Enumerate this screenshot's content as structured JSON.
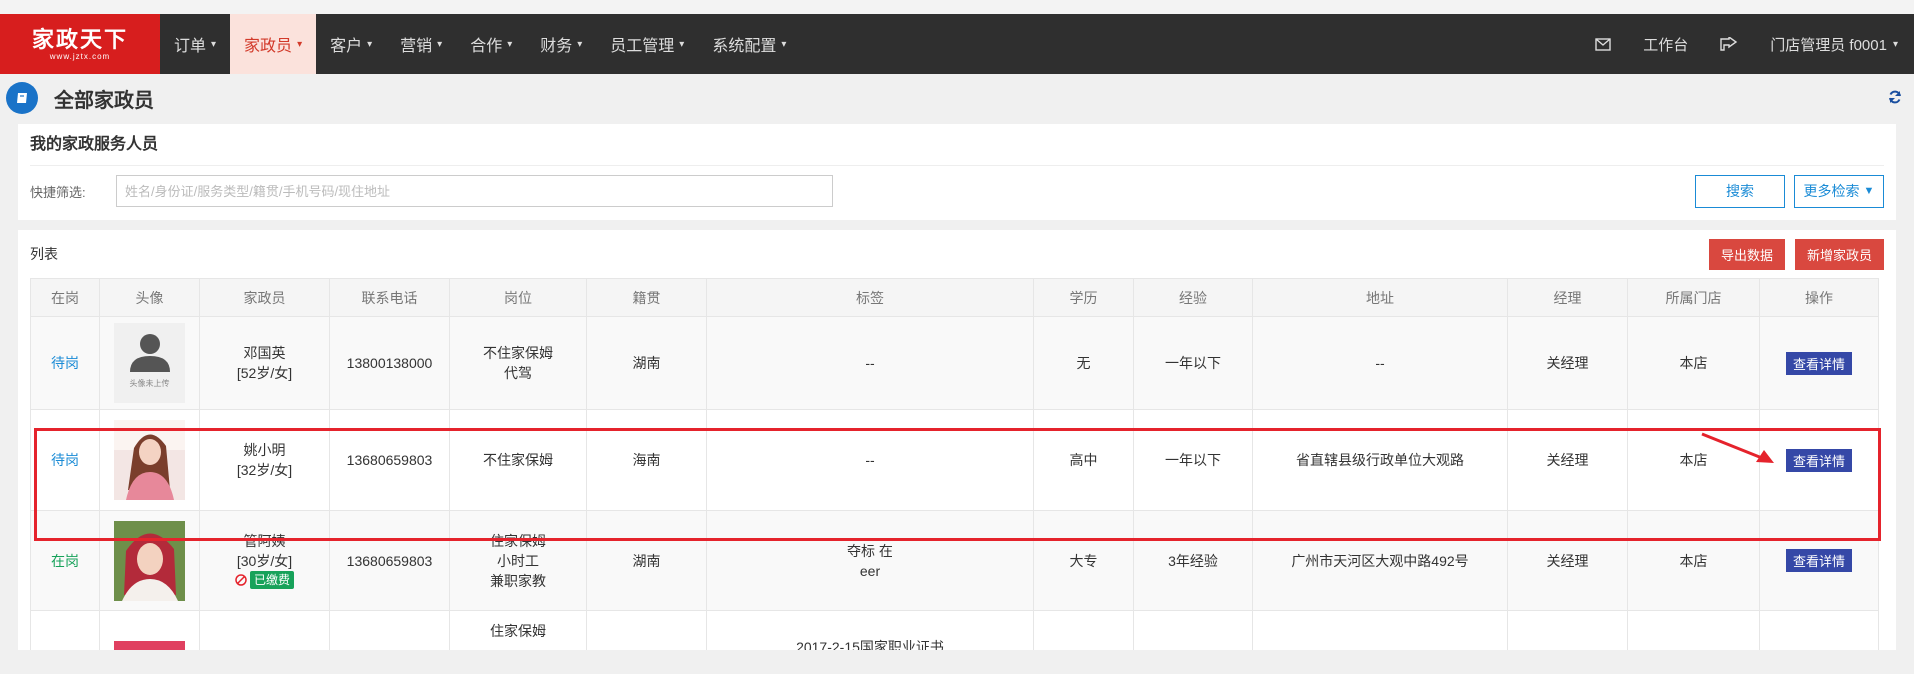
{
  "logo": {
    "brand": "家政天下",
    "domain": "www.jztx.com"
  },
  "nav": {
    "items": [
      {
        "label": "订单"
      },
      {
        "label": "家政员"
      },
      {
        "label": "客户"
      },
      {
        "label": "营销"
      },
      {
        "label": "合作"
      },
      {
        "label": "财务"
      },
      {
        "label": "员工管理"
      },
      {
        "label": "系统配置"
      }
    ],
    "workbench": "工作台",
    "user": "门店管理员 f0001"
  },
  "page": {
    "title": "全部家政员"
  },
  "filter": {
    "title": "我的家政服务人员",
    "label": "快捷筛选:",
    "placeholder": "姓名/身份证/服务类型/籍贯/手机号码/现住地址",
    "search_label": "搜索",
    "more_label": "更多检索"
  },
  "list": {
    "title": "列表",
    "export_label": "导出数据",
    "add_label": "新增家政员",
    "columns": [
      "在岗",
      "头像",
      "家政员",
      "联系电话",
      "岗位",
      "籍贯",
      "标签",
      "学历",
      "经验",
      "地址",
      "经理",
      "所属门店",
      "操作"
    ],
    "rows": [
      {
        "status": "待岗",
        "avatar_caption": "头像未上传",
        "name": "邓国英",
        "meta": "[52岁/女]",
        "phone": "13800138000",
        "pos1": "不住家保姆",
        "pos2": "代驾",
        "pos3": "",
        "origin": "湖南",
        "tag1": "--",
        "tag2": "",
        "education": "无",
        "experience": "一年以下",
        "address": "--",
        "manager": "关经理",
        "store": "本店",
        "action": "查看详情"
      },
      {
        "status": "待岗",
        "name": "姚小明",
        "meta": "[32岁/女]",
        "phone": "13680659803",
        "pos1": "不住家保姆",
        "pos2": "",
        "pos3": "",
        "origin": "海南",
        "tag1": "--",
        "tag2": "",
        "education": "高中",
        "experience": "一年以下",
        "address": "省直辖县级行政单位大观路",
        "manager": "关经理",
        "store": "本店",
        "action": "查看详情"
      },
      {
        "status": "在岗",
        "name": "管阿姨",
        "meta": "[30岁/女]",
        "paid": "已缴费",
        "phone": "13680659803",
        "pos1": "住家保姆",
        "pos2": "小时工",
        "pos3": "兼职家教",
        "origin": "湖南",
        "tag1": "夺标 在",
        "tag2": "eer",
        "education": "大专",
        "experience": "3年经验",
        "address": "广州市天河区大观中路492号",
        "manager": "关经理",
        "store": "本店",
        "action": "查看详情"
      },
      {
        "pos1": "住家保姆",
        "pos2": "",
        "tag1": "2017-2-15国家职业证书"
      }
    ]
  },
  "colors": {
    "brand_red": "#d71e1e",
    "nav_bg": "#2f2f2f",
    "detail_btn": "#3548a7",
    "highlight": "#e5232c"
  }
}
